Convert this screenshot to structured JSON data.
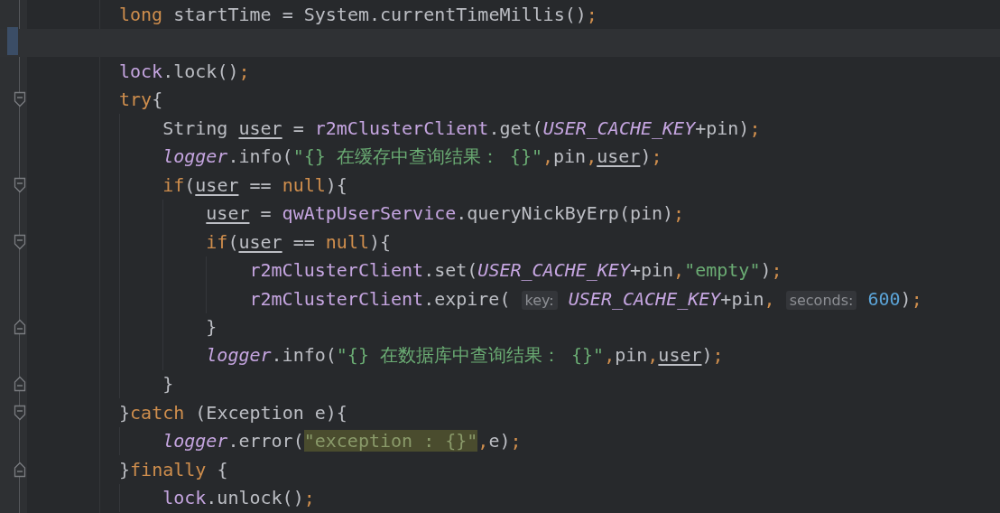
{
  "lines": [
    {
      "kind": "statement",
      "current": false,
      "tokens": [
        {
          "kind": "kw",
          "text": "long "
        },
        {
          "kind": "plain",
          "text": "startTime = System.currentTimeMillis()"
        },
        {
          "kind": "punct",
          "text": ";"
        }
      ]
    },
    {
      "kind": "blank",
      "current": true
    },
    {
      "kind": "statement",
      "current": false,
      "tokens": [
        {
          "kind": "field",
          "text": "lock"
        },
        {
          "kind": "plain",
          "text": ".lock()"
        },
        {
          "kind": "punct",
          "text": ";"
        }
      ]
    },
    {
      "kind": "block-start",
      "current": false,
      "tokens": [
        {
          "kind": "kw",
          "text": "try"
        },
        {
          "kind": "plain",
          "text": "{"
        }
      ],
      "children": [
        {
          "kind": "statement",
          "current": false,
          "tokens": [
            {
              "kind": "plain",
              "text": "String "
            },
            {
              "kind": "var",
              "text": "user"
            },
            {
              "kind": "plain",
              "text": " = "
            },
            {
              "kind": "field",
              "text": "r2mClusterClient"
            },
            {
              "kind": "plain",
              "text": ".get("
            },
            {
              "kind": "const",
              "text": "USER_CACHE_KEY"
            },
            {
              "kind": "plain",
              "text": "+pin)"
            },
            {
              "kind": "punct",
              "text": ";"
            }
          ]
        },
        {
          "kind": "statement",
          "current": false,
          "tokens": [
            {
              "kind": "logger",
              "text": "logger"
            },
            {
              "kind": "plain",
              "text": ".info("
            },
            {
              "kind": "str",
              "text": "\"{} 在缓存中查询结果： {}\""
            },
            {
              "kind": "punct",
              "text": ","
            },
            {
              "kind": "plain",
              "text": "pin"
            },
            {
              "kind": "punct",
              "text": ","
            },
            {
              "kind": "var",
              "text": "user"
            },
            {
              "kind": "plain",
              "text": ")"
            },
            {
              "kind": "punct",
              "text": ";"
            }
          ]
        },
        {
          "kind": "block-start",
          "current": false,
          "tokens": [
            {
              "kind": "kw",
              "text": "if"
            },
            {
              "kind": "plain",
              "text": "("
            },
            {
              "kind": "var",
              "text": "user"
            },
            {
              "kind": "plain",
              "text": " == "
            },
            {
              "kind": "kw",
              "text": "null"
            },
            {
              "kind": "plain",
              "text": "){"
            }
          ],
          "children": [
            {
              "kind": "statement",
              "current": false,
              "tokens": [
                {
                  "kind": "var",
                  "text": "user"
                },
                {
                  "kind": "plain",
                  "text": " = "
                },
                {
                  "kind": "field",
                  "text": "qwAtpUserService"
                },
                {
                  "kind": "plain",
                  "text": ".queryNickByErp(pin)"
                },
                {
                  "kind": "punct",
                  "text": ";"
                }
              ]
            },
            {
              "kind": "block-start",
              "current": false,
              "tokens": [
                {
                  "kind": "kw",
                  "text": "if"
                },
                {
                  "kind": "plain",
                  "text": "("
                },
                {
                  "kind": "var",
                  "text": "user"
                },
                {
                  "kind": "plain",
                  "text": " == "
                },
                {
                  "kind": "kw",
                  "text": "null"
                },
                {
                  "kind": "plain",
                  "text": "){"
                }
              ],
              "children": [
                {
                  "kind": "statement",
                  "current": false,
                  "tokens": [
                    {
                      "kind": "field",
                      "text": "r2mClusterClient"
                    },
                    {
                      "kind": "plain",
                      "text": ".set("
                    },
                    {
                      "kind": "const",
                      "text": "USER_CACHE_KEY"
                    },
                    {
                      "kind": "plain",
                      "text": "+pin"
                    },
                    {
                      "kind": "punct",
                      "text": ","
                    },
                    {
                      "kind": "str",
                      "text": "\"empty\""
                    },
                    {
                      "kind": "plain",
                      "text": ")"
                    },
                    {
                      "kind": "punct",
                      "text": ";"
                    }
                  ]
                },
                {
                  "kind": "statement",
                  "current": false,
                  "tokens": [
                    {
                      "kind": "field",
                      "text": "r2mClusterClient"
                    },
                    {
                      "kind": "plain",
                      "text": ".expire( "
                    },
                    {
                      "kind": "hint",
                      "text": "key:"
                    },
                    {
                      "kind": "const",
                      "text": " USER_CACHE_KEY"
                    },
                    {
                      "kind": "plain",
                      "text": "+pin"
                    },
                    {
                      "kind": "punct",
                      "text": ", "
                    },
                    {
                      "kind": "hint",
                      "text": "seconds:"
                    },
                    {
                      "kind": "num",
                      "text": " 600"
                    },
                    {
                      "kind": "plain",
                      "text": ")"
                    },
                    {
                      "kind": "punct",
                      "text": ";"
                    }
                  ]
                }
              ]
            },
            {
              "kind": "block-end",
              "current": false,
              "tokens": [
                {
                  "kind": "plain",
                  "text": "}"
                }
              ]
            },
            {
              "kind": "statement",
              "current": false,
              "tokens": [
                {
                  "kind": "logger",
                  "text": "logger"
                },
                {
                  "kind": "plain",
                  "text": ".info("
                },
                {
                  "kind": "str",
                  "text": "\"{} 在数据库中查询结果： {}\""
                },
                {
                  "kind": "punct",
                  "text": ","
                },
                {
                  "kind": "plain",
                  "text": "pin"
                },
                {
                  "kind": "punct",
                  "text": ","
                },
                {
                  "kind": "var",
                  "text": "user"
                },
                {
                  "kind": "plain",
                  "text": ")"
                },
                {
                  "kind": "punct",
                  "text": ";"
                }
              ]
            }
          ]
        },
        {
          "kind": "block-end",
          "current": false,
          "tokens": [
            {
              "kind": "plain",
              "text": "}"
            }
          ]
        }
      ]
    },
    {
      "kind": "block-start",
      "current": false,
      "tokens": [
        {
          "kind": "plain",
          "text": "}"
        },
        {
          "kind": "kw",
          "text": "catch"
        },
        {
          "kind": "plain",
          "text": " (Exception e){"
        }
      ],
      "children": [
        {
          "kind": "statement",
          "current": false,
          "tokens": [
            {
              "kind": "logger",
              "text": "logger"
            },
            {
              "kind": "plain",
              "text": ".error("
            },
            {
              "kind": "match",
              "text": "\"exception : {}\""
            },
            {
              "kind": "punct",
              "text": ","
            },
            {
              "kind": "plain",
              "text": "e)"
            },
            {
              "kind": "punct",
              "text": ";"
            }
          ]
        }
      ]
    },
    {
      "kind": "block-end",
      "current": false,
      "tokens": [
        {
          "kind": "plain",
          "text": "}"
        },
        {
          "kind": "kw",
          "text": "finally"
        },
        {
          "kind": "plain",
          "text": " {"
        }
      ],
      "children": [
        {
          "kind": "statement",
          "current": false,
          "tokens": [
            {
              "kind": "field",
              "text": "lock"
            },
            {
              "kind": "plain",
              "text": ".unlock()"
            },
            {
              "kind": "punct",
              "text": ";"
            }
          ]
        }
      ]
    }
  ]
}
